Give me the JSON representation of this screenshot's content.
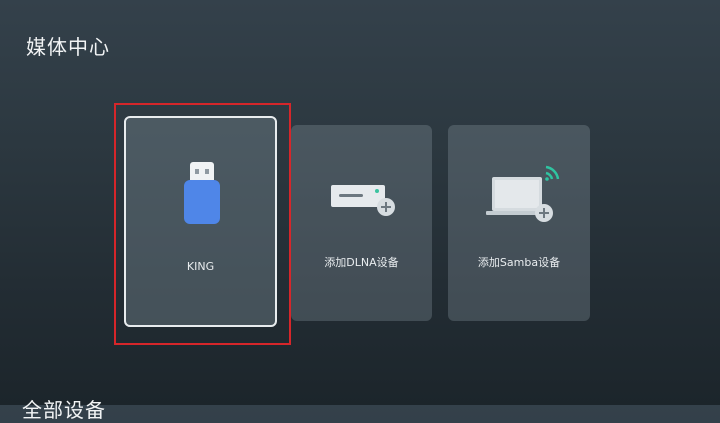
{
  "page": {
    "title": "媒体中心",
    "next_section_title": "全部设备"
  },
  "devices": [
    {
      "label": "KING",
      "icon": "usb-drive-icon",
      "selected": true
    },
    {
      "label": "添加DLNA设备",
      "icon": "add-dlna-device-icon",
      "selected": false
    },
    {
      "label": "添加Samba设备",
      "icon": "add-samba-device-icon",
      "selected": false
    }
  ],
  "colors": {
    "focus_highlight": "#d6262a",
    "usb_icon_blue": "#4f86e8",
    "plus_badge": "#d7dde1",
    "dlna_led": "#3cc3a0",
    "wifi_green": "#2fc4a1"
  }
}
